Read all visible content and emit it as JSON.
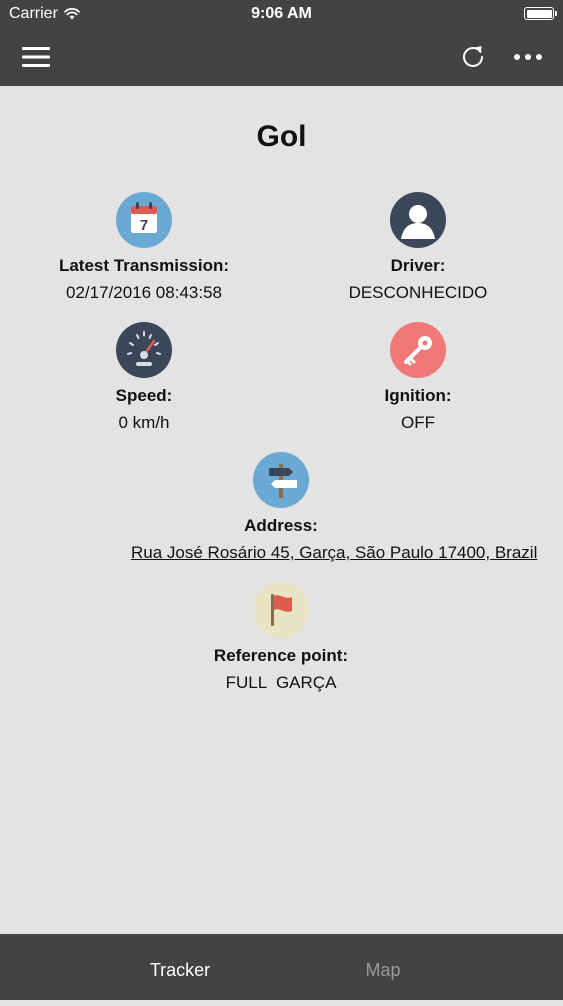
{
  "status_bar": {
    "carrier": "Carrier",
    "time": "9:06 AM"
  },
  "nav": {
    "icons": [
      "hamburger-menu-icon",
      "refresh-icon",
      "more-icon"
    ]
  },
  "vehicle": {
    "name": "Gol"
  },
  "fields": {
    "latest_transmission": {
      "label": "Latest Transmission:",
      "value": "02/17/2016 08:43:58",
      "icon": "calendar-icon"
    },
    "driver": {
      "label": "Driver:",
      "value": "DESCONHECIDO",
      "icon": "person-icon"
    },
    "speed": {
      "label": "Speed:",
      "value": "0 km/h",
      "icon": "speedometer-icon"
    },
    "ignition": {
      "label": "Ignition:",
      "value": "OFF",
      "icon": "key-icon"
    },
    "address": {
      "label": "Address:",
      "value": "Rua José Rosário 45, Garça, São Paulo 17400, Brazil",
      "icon": "signpost-icon"
    },
    "reference_point": {
      "label": "Reference point:",
      "value": "FULL  GARÇA",
      "icon": "flag-icon"
    }
  },
  "calendar_day": "7",
  "colors": {
    "bar_background": "#434343",
    "content_background": "#e3e3e3",
    "icon_blue": "#6aa9d3",
    "icon_dark": "#3b4658",
    "icon_red": "#f07878",
    "icon_flag_bg": "#e9e4c4",
    "tab_active": "#ffffff",
    "tab_inactive": "#9a9a9a"
  },
  "tabs": [
    {
      "label": "Tracker",
      "active": true
    },
    {
      "label": "Map",
      "active": false
    }
  ]
}
